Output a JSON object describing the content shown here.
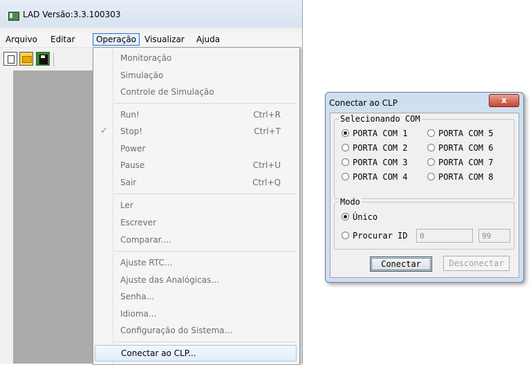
{
  "window": {
    "title": "LAD Versão:3.3.100303"
  },
  "menubar": {
    "items": [
      {
        "label": "Arquivo"
      },
      {
        "label": "Editar"
      },
      {
        "label": "Operação"
      },
      {
        "label": "Visualizar"
      },
      {
        "label": "Ajuda"
      }
    ],
    "active": "Operação"
  },
  "toolbar": {
    "buttons": [
      "new-file-icon",
      "open-folder-icon",
      "save-disk-icon"
    ]
  },
  "operation_menu": {
    "items": [
      {
        "label": "Monitoração",
        "shortcut": "",
        "enabled": false
      },
      {
        "label": "Simulação",
        "shortcut": "",
        "enabled": false
      },
      {
        "label": "Controle de Simulação",
        "shortcut": "",
        "enabled": false
      },
      {
        "label": "Run!",
        "shortcut": "Ctrl+R",
        "enabled": false
      },
      {
        "label": "Stop!",
        "shortcut": "Ctrl+T",
        "enabled": false,
        "checked": true,
        "check": "✓"
      },
      {
        "label": "Power",
        "shortcut": "",
        "enabled": false
      },
      {
        "label": "Pause",
        "shortcut": "Ctrl+U",
        "enabled": false
      },
      {
        "label": "Sair",
        "shortcut": "Ctrl+Q",
        "enabled": false
      },
      {
        "label": "Ler",
        "shortcut": "",
        "enabled": false
      },
      {
        "label": "Escrever",
        "shortcut": "",
        "enabled": false
      },
      {
        "label": "Comparar....",
        "shortcut": "",
        "enabled": false
      },
      {
        "label": "Ajuste RTC...",
        "shortcut": "",
        "enabled": false
      },
      {
        "label": "Ajuste das Analógicas...",
        "shortcut": "",
        "enabled": false
      },
      {
        "label": "Senha...",
        "shortcut": "",
        "enabled": false
      },
      {
        "label": "Idioma...",
        "shortcut": "",
        "enabled": false
      },
      {
        "label": "Configuração do Sistema...",
        "shortcut": "",
        "enabled": false
      },
      {
        "label": "Conectar ao CLP...",
        "shortcut": "",
        "enabled": true,
        "highlighted": true
      }
    ]
  },
  "dialog": {
    "title": "Conectar ao CLP",
    "close_label": "x",
    "com_group": {
      "legend": "Selecionando COM",
      "ports": [
        {
          "label": "PORTA COM 1",
          "selected": true
        },
        {
          "label": "PORTA COM 2",
          "selected": false
        },
        {
          "label": "PORTA COM 3",
          "selected": false
        },
        {
          "label": "PORTA COM 4",
          "selected": false
        },
        {
          "label": "PORTA COM 5",
          "selected": false
        },
        {
          "label": "PORTA COM 6",
          "selected": false
        },
        {
          "label": "PORTA COM 7",
          "selected": false
        },
        {
          "label": "PORTA COM 8",
          "selected": false
        }
      ]
    },
    "mode_group": {
      "legend": "Modo",
      "unico_label": "Único",
      "unico_selected": true,
      "procurar_label": "Procurar ID",
      "procurar_selected": false,
      "id_from": "0",
      "id_to": "99"
    },
    "connect_label": "Conectar",
    "disconnect_label": "Desconectar"
  }
}
